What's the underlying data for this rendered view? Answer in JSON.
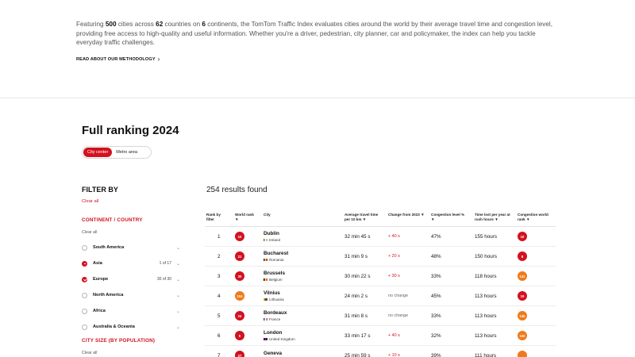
{
  "intro": {
    "p1": "Featuring ",
    "n_cities": "500",
    "p2": " cities across ",
    "n_countries": "62",
    "p3": " countries on ",
    "n_continents": "6",
    "p4": " continents, the TomTom Traffic Index evaluates cities around the world by their average travel time and congestion level, providing free access to high-quality and useful information. Whether you're a driver, pedestrian, city planner, car and policymaker, the index can help you tackle everyday traffic challenges.",
    "methodology_link": "READ ABOUT OUR METHODOLOGY",
    "methodology_chevron": "›"
  },
  "ranking": {
    "title": "Full ranking 2024",
    "toggle": {
      "city_center": "City center",
      "metro_area": "Metro area"
    }
  },
  "filter": {
    "title": "FILTER BY",
    "clear_all": "Clear all",
    "continent_title": "CONTINENT  /  COUNTRY",
    "continent_clear": "Clear all",
    "regions": [
      {
        "label": "South America",
        "count": "",
        "state": "none"
      },
      {
        "label": "Asia",
        "count": "1 of 17",
        "state": "partial"
      },
      {
        "label": "Europe",
        "count": "30 of 30",
        "state": "checked"
      },
      {
        "label": "North America",
        "count": "",
        "state": "none"
      },
      {
        "label": "Africa",
        "count": "",
        "state": "none"
      },
      {
        "label": "Australia & Oceania",
        "count": "",
        "state": "none"
      }
    ],
    "chevron": "⌄",
    "city_size_title": "CITY SIZE (BY POPULATION)",
    "city_size_clear": "Clear all"
  },
  "results": {
    "label": "254 results found"
  },
  "table": {
    "headers": {
      "rank": "Rank by\nfilter",
      "world": "World rank\n▼",
      "city": "City",
      "travel": "Average travel time\nper 10 km ▼",
      "change": "Change from 2023 ▼",
      "level": "Congestion level %\n▼",
      "lost": "Time lost per year at\nrush hours ▼",
      "cwr": "Congestion world\nrank ▼"
    },
    "rows": [
      {
        "rank": "1",
        "world": "10",
        "city": "Dublin",
        "country": "Ireland",
        "flag": [
          "#169b62",
          "#ffffff",
          "#ff883e"
        ],
        "travel": "32 min 45 s",
        "change": "+ 40 s",
        "change_type": "red",
        "level": "47%",
        "lost": "155 hours",
        "cwr": "10",
        "cwr_color": "#d3111f"
      },
      {
        "rank": "2",
        "world": "22",
        "city": "Bucharest",
        "country": "Romania",
        "flag": [
          "#002b7f",
          "#fcd116",
          "#ce1126"
        ],
        "travel": "31 min 9 s",
        "change": "+ 20 s",
        "change_type": "red",
        "level": "48%",
        "lost": "150 hours",
        "cwr": "8",
        "cwr_color": "#d3111f"
      },
      {
        "rank": "3",
        "world": "30",
        "city": "Brussels",
        "country": "Belgium",
        "flag": [
          "#000000",
          "#fdda24",
          "#ef3340"
        ],
        "travel": "30 min 22 s",
        "change": "+ 30 s",
        "change_type": "red",
        "level": "33%",
        "lost": "118 hours",
        "cwr": "141",
        "cwr_color": "#f07a1a"
      },
      {
        "rank": "4",
        "world": "104",
        "city": "Vilnius",
        "country": "Lithuania",
        "flag": [
          "#fdb913",
          "#006a44",
          "#c1272d"
        ],
        "travel": "24 min 2 s",
        "change": "no change",
        "change_type": "grey",
        "level": "45%",
        "lost": "113 hours",
        "cwr": "19",
        "cwr_color": "#d3111f"
      },
      {
        "rank": "5",
        "world": "24",
        "city": "Bordeaux",
        "country": "France",
        "flag": [
          "#0055a4",
          "#ffffff",
          "#ef4135"
        ],
        "travel": "31 min 8 s",
        "change": "no change",
        "change_type": "grey",
        "level": "33%",
        "lost": "113 hours",
        "cwr": "145",
        "cwr_color": "#f07a1a"
      },
      {
        "rank": "6",
        "world": "8",
        "city": "London",
        "country": "United Kingdom",
        "flag": [
          "#012169",
          "#c8102e",
          "#012169"
        ],
        "travel": "33 min 17 s",
        "change": "+ 40 s",
        "change_type": "red",
        "level": "32%",
        "lost": "113 hours",
        "cwr": "150",
        "cwr_color": "#f07a1a"
      },
      {
        "rank": "7",
        "world": "27",
        "city": "Geneva",
        "country": "",
        "flag": [
          "#ffffff",
          "#ffffff",
          "#ffffff"
        ],
        "travel": "25 min 59 s",
        "change": "+ 10 s",
        "change_type": "red",
        "level": "39%",
        "lost": "111 hours",
        "cwr": "",
        "cwr_color": "#f07a1a"
      }
    ]
  },
  "colors": {
    "accent": "#d3111f",
    "world_badge": "#d3111f",
    "world_badge_orange": "#f07a1a"
  }
}
